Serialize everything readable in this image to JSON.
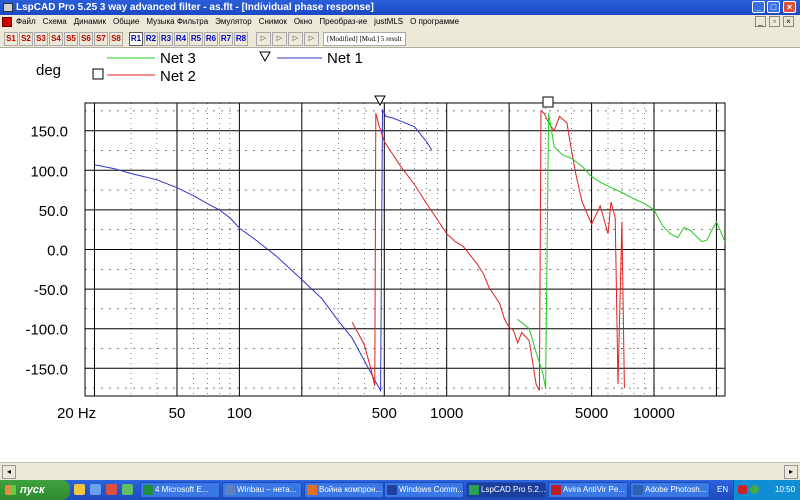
{
  "window": {
    "title": "LspCAD Pro 5.25 3 way advanced filter - as.flt - [Individual phase response]"
  },
  "menu": {
    "items": [
      "Файл",
      "Схема",
      "Динамик",
      "Общие",
      "Музыка Фильтра",
      "Эмулятор",
      "Снимок",
      "Окно",
      "Преобраз-ие",
      "justMLS",
      "О программе"
    ]
  },
  "toolbar": {
    "s_buttons": [
      "S1",
      "S2",
      "S3",
      "S4",
      "S5",
      "S6",
      "S7",
      "S8"
    ],
    "r_buttons": [
      "R1",
      "R2",
      "R3",
      "R4",
      "R5",
      "R6",
      "R7",
      "R8"
    ],
    "status": "[Modified] [Mod.] 5 result"
  },
  "plot": {
    "ylabel": "deg",
    "y_ticks": [
      "150.0",
      "100.0",
      "50.0",
      "0.0",
      "-50.0",
      "-100.0",
      "-150.0"
    ],
    "x_ticks": [
      "20 Hz",
      "50",
      "100",
      "500",
      "1000",
      "5000",
      "10000"
    ]
  },
  "legend": {
    "net3": "Net 3",
    "net2": "Net 2",
    "net1": "Net 1"
  },
  "colors": {
    "net1": "#3333cc",
    "net2": "#e02020",
    "net3": "#22cc22",
    "titlebar": "#2456d0",
    "taskbar": "#245edb",
    "start": "#3a9a3a"
  },
  "chart_data": {
    "type": "line",
    "title": "",
    "xlabel": "",
    "ylabel": "deg",
    "x_scale": "log",
    "xlim": [
      18,
      22000
    ],
    "ylim": [
      -185,
      185
    ],
    "grid": true,
    "legend_placement": "top-left",
    "series": [
      {
        "name": "Net 1",
        "points": [
          [
            20,
            107
          ],
          [
            25,
            102
          ],
          [
            30,
            96
          ],
          [
            40,
            88
          ],
          [
            50,
            78
          ],
          [
            60,
            68
          ],
          [
            70,
            58
          ],
          [
            80,
            50
          ],
          [
            90,
            40
          ],
          [
            100,
            27
          ],
          [
            120,
            12
          ],
          [
            150,
            -8
          ],
          [
            200,
            -38
          ],
          [
            250,
            -62
          ],
          [
            300,
            -90
          ],
          [
            350,
            -112
          ],
          [
            400,
            -140
          ],
          [
            450,
            -165
          ],
          [
            480,
            -178
          ],
          [
            490,
            176
          ],
          [
            510,
            168
          ],
          [
            550,
            166
          ],
          [
            600,
            162
          ],
          [
            700,
            155
          ],
          [
            800,
            136
          ],
          [
            850,
            125
          ]
        ]
      },
      {
        "name": "Net 2",
        "points": [
          [
            350,
            -92
          ],
          [
            400,
            -120
          ],
          [
            430,
            -150
          ],
          [
            450,
            -172
          ],
          [
            455,
            172
          ],
          [
            470,
            158
          ],
          [
            500,
            136
          ],
          [
            550,
            120
          ],
          [
            600,
            105
          ],
          [
            700,
            82
          ],
          [
            800,
            58
          ],
          [
            900,
            38
          ],
          [
            1000,
            20
          ],
          [
            1100,
            10
          ],
          [
            1200,
            4
          ],
          [
            1400,
            -18
          ],
          [
            1500,
            -30
          ],
          [
            1600,
            -48
          ],
          [
            1800,
            -68
          ],
          [
            1900,
            -88
          ],
          [
            2000,
            -98
          ],
          [
            2100,
            -102
          ],
          [
            2200,
            -118
          ],
          [
            2300,
            -105
          ],
          [
            2500,
            -115
          ],
          [
            2700,
            -170
          ],
          [
            2800,
            -178
          ],
          [
            2850,
            175
          ],
          [
            2950,
            172
          ],
          [
            3100,
            160
          ],
          [
            3300,
            150
          ],
          [
            3500,
            168
          ],
          [
            3800,
            160
          ],
          [
            4000,
            125
          ],
          [
            4200,
            95
          ],
          [
            4500,
            60
          ],
          [
            5000,
            32
          ],
          [
            5500,
            55
          ],
          [
            6000,
            20
          ],
          [
            6200,
            60
          ],
          [
            6500,
            40
          ],
          [
            6700,
            -170
          ],
          [
            7000,
            35
          ],
          [
            7200,
            -175
          ]
        ]
      },
      {
        "name": "Net 3",
        "points": [
          [
            2200,
            -88
          ],
          [
            2500,
            -100
          ],
          [
            2700,
            -130
          ],
          [
            2900,
            -155
          ],
          [
            3000,
            -175
          ],
          [
            3100,
            172
          ],
          [
            3300,
            130
          ],
          [
            3600,
            120
          ],
          [
            4000,
            115
          ],
          [
            4500,
            105
          ],
          [
            5000,
            92
          ],
          [
            5500,
            85
          ],
          [
            6000,
            80
          ],
          [
            7000,
            72
          ],
          [
            8000,
            64
          ],
          [
            9000,
            58
          ],
          [
            10000,
            50
          ],
          [
            11000,
            30
          ],
          [
            12000,
            20
          ],
          [
            13000,
            15
          ],
          [
            14000,
            28
          ],
          [
            15000,
            24
          ],
          [
            17000,
            10
          ],
          [
            18000,
            12
          ],
          [
            20000,
            35
          ],
          [
            22000,
            10
          ]
        ]
      }
    ]
  },
  "taskbar": {
    "start_label": "пуск",
    "tasks": [
      "4 Microsoft E...",
      "Winbau – нета...",
      "Война компрон...",
      "Windows Comm...",
      "LspCAD Pro 5.2...",
      "Avira AntiVir Pe...",
      "Adobe Photosh..."
    ],
    "lang": "EN",
    "clock": "10:50"
  }
}
